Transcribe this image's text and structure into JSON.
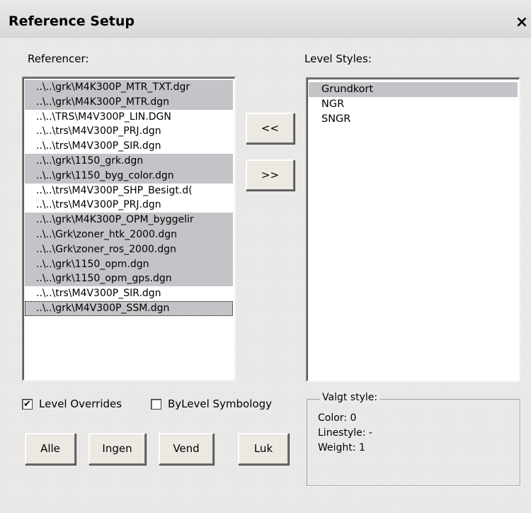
{
  "window": {
    "title": "Reference Setup",
    "close_glyph": "×",
    "close_icon": "close-icon"
  },
  "references": {
    "label": "Referencer:",
    "items": [
      {
        "name": "..\\..\\grk\\M4K300P_MTR_TXT.dgr",
        "selected": true
      },
      {
        "name": "..\\..\\grk\\M4K300P_MTR.dgn",
        "selected": true
      },
      {
        "name": "..\\..\\TRS\\M4V300P_LIN.DGN",
        "selected": false
      },
      {
        "name": "..\\..\\trs\\M4V300P_PRJ.dgn",
        "selected": false
      },
      {
        "name": "..\\..\\trs\\M4V300P_SIR.dgn",
        "selected": false
      },
      {
        "name": "..\\..\\grk\\1150_grk.dgn",
        "selected": true
      },
      {
        "name": "..\\..\\grk\\1150_byg_color.dgn",
        "selected": true
      },
      {
        "name": "..\\..\\trs\\M4V300P_SHP_Besigt.d(",
        "selected": false
      },
      {
        "name": "..\\..\\trs\\M4V300P_PRJ.dgn",
        "selected": false
      },
      {
        "name": "..\\..\\grk\\M4K300P_OPM_byggelir",
        "selected": true
      },
      {
        "name": "..\\..\\Grk\\zoner_htk_2000.dgn",
        "selected": true
      },
      {
        "name": "..\\..\\Grk\\zoner_ros_2000.dgn",
        "selected": true
      },
      {
        "name": "..\\..\\grk\\1150_opm.dgn",
        "selected": true
      },
      {
        "name": "..\\..\\grk\\1150_opm_gps.dgn",
        "selected": true
      },
      {
        "name": "..\\..\\trs\\M4V300P_SIR.dgn",
        "selected": false
      },
      {
        "name": "..\\..\\grk\\M4V300P_SSM.dgn",
        "selected": true,
        "focused": true
      }
    ]
  },
  "transfer": {
    "add_label": "<<",
    "remove_label": ">>"
  },
  "level_styles": {
    "label": "Level Styles:",
    "items": [
      {
        "name": "Grundkort",
        "selected": true
      },
      {
        "name": "NGR",
        "selected": false
      },
      {
        "name": "SNGR",
        "selected": false
      }
    ]
  },
  "options": {
    "level_overrides": {
      "label": "Level Overrides",
      "checked": true
    },
    "bylevel_symbology": {
      "label": "ByLevel Symbology",
      "checked": false
    }
  },
  "buttons": {
    "alle": "Alle",
    "ingen": "Ingen",
    "vend": "Vend",
    "luk": "Luk"
  },
  "selected_style": {
    "legend": "Valgt style:",
    "color": "Color: 0",
    "linestyle": "Linestyle: -",
    "weight": "Weight: 1"
  }
}
